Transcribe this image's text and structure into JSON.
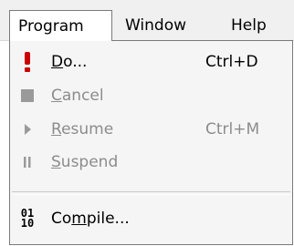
{
  "menubar": {
    "items": [
      {
        "label": "Program",
        "active": true
      },
      {
        "label": "Window"
      },
      {
        "label": "Help"
      }
    ]
  },
  "program_menu": {
    "items": [
      {
        "label_pre": "",
        "mnemonic": "D",
        "label_post": "o...",
        "shortcut": "Ctrl+D",
        "icon": "exclamation-icon",
        "enabled": true
      },
      {
        "label_pre": "",
        "mnemonic": "C",
        "label_post": "ancel",
        "shortcut": "",
        "icon": "stop-square-icon",
        "enabled": false
      },
      {
        "label_pre": "",
        "mnemonic": "R",
        "label_post": "esume",
        "shortcut": "Ctrl+M",
        "icon": "play-triangle-icon",
        "enabled": false
      },
      {
        "label_pre": "",
        "mnemonic": "S",
        "label_post": "uspend",
        "shortcut": "",
        "icon": "pause-icon",
        "enabled": false
      },
      {
        "label_pre": "Co",
        "mnemonic": "m",
        "label_post": "pile...",
        "shortcut": "",
        "icon": "binary-icon",
        "enabled": true
      }
    ],
    "binary_icon_top": "01",
    "binary_icon_bottom": "10"
  },
  "colors": {
    "exclamation": "#cc0000",
    "disabled_icon": "#9a9a9a",
    "disabled_text": "#8c8c8c"
  }
}
